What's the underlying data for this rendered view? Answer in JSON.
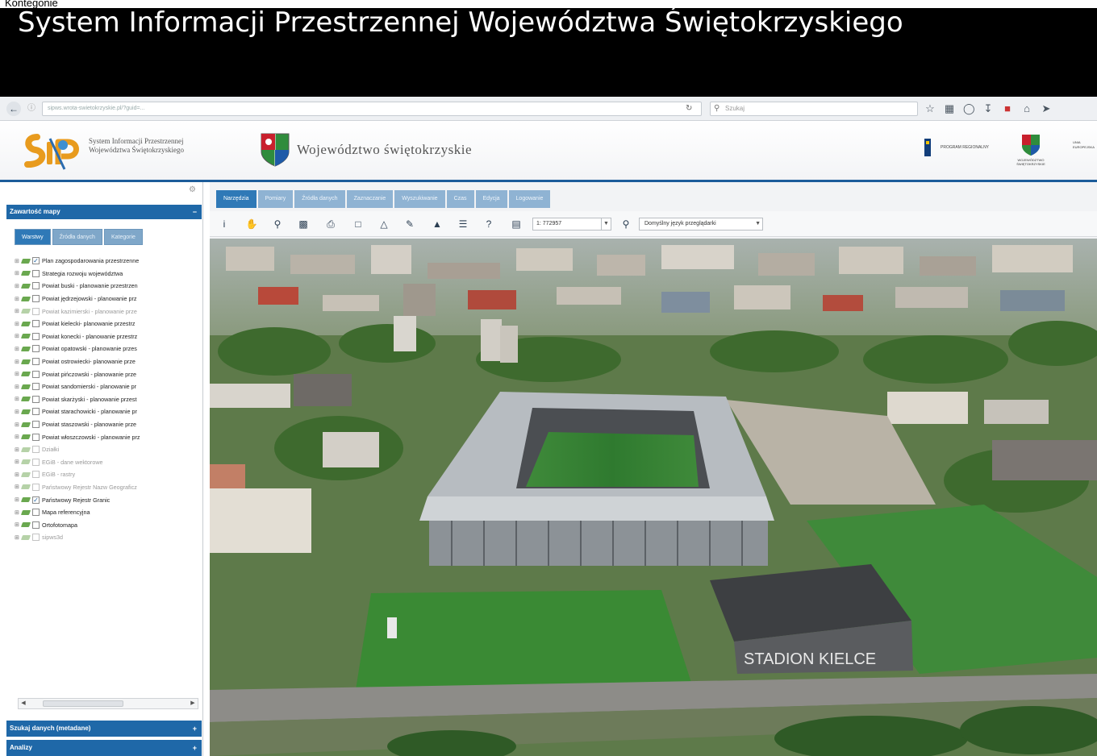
{
  "video": {
    "cut_text": "Kontegonie",
    "title": "System Informacji Przestrzennej Województwa Świętokrzyskiego"
  },
  "browser": {
    "url": "sipws.wrota-swietokrzyskie.pl/?guid=...",
    "search_placeholder": "Szukaj"
  },
  "header": {
    "sip_name_line1": "System Informacji Przestrzennej",
    "sip_name_line2": "Województwa Świętokrzyskiego",
    "region_name": "Województwo świętokrzyskie",
    "partner_name": "PROGRAM REGIONALNY",
    "crest_caption_line1": "WOJEWÓDZTWO",
    "crest_caption_line2": "ŚWIĘTOKRZYSKIE",
    "edge_line1": "UNIA",
    "edge_line2": "EUROPEJSKA"
  },
  "panel": {
    "title": "Zawartość mapy",
    "tabs": [
      "Warstwy",
      "Źródła danych",
      "Kategorie"
    ],
    "layers": [
      {
        "label": "Plan zagospodarowania przestrzenne",
        "checked": true,
        "dim": false
      },
      {
        "label": "Strategia rozwoju województwa",
        "checked": false,
        "dim": false
      },
      {
        "label": "Powiat buski - planowanie przestrzen",
        "checked": false,
        "dim": false
      },
      {
        "label": "Powiat jędrzejowski - planowanie prz",
        "checked": false,
        "dim": false
      },
      {
        "label": "Powiat kazimierski - planowanie prze",
        "checked": false,
        "dim": true
      },
      {
        "label": "Powiat kielecki- planowanie przestrz",
        "checked": false,
        "dim": false
      },
      {
        "label": "Powiat konecki - planowanie przestrz",
        "checked": false,
        "dim": false
      },
      {
        "label": "Powiat opatowski - planowanie przes",
        "checked": false,
        "dim": false
      },
      {
        "label": "Powiat ostrowiecki- planowanie prze",
        "checked": false,
        "dim": false
      },
      {
        "label": "Powiat pińczowski - planowanie prze",
        "checked": false,
        "dim": false
      },
      {
        "label": "Powiat sandomierski - planowanie pr",
        "checked": false,
        "dim": false
      },
      {
        "label": "Powiat skarżyski - planowanie przest",
        "checked": false,
        "dim": false
      },
      {
        "label": "Powiat starachowicki - planowanie pr",
        "checked": false,
        "dim": false
      },
      {
        "label": "Powiat staszowski - planowanie prze",
        "checked": false,
        "dim": false
      },
      {
        "label": "Powiat włoszczowski - planowanie prz",
        "checked": false,
        "dim": false
      },
      {
        "label": "Działki",
        "checked": false,
        "dim": true
      },
      {
        "label": "EGiB - dane wektorowe",
        "checked": false,
        "dim": true
      },
      {
        "label": "EGiB - rastry",
        "checked": false,
        "dim": true
      },
      {
        "label": "Państwowy Rejestr Nazw Geograficz",
        "checked": false,
        "dim": true
      },
      {
        "label": "Państwowy Rejestr Granic",
        "checked": true,
        "dim": false
      },
      {
        "label": "Mapa referencyjna",
        "checked": false,
        "dim": false
      },
      {
        "label": "Ortofotomapa",
        "checked": false,
        "dim": false
      },
      {
        "label": "sipws3d",
        "checked": false,
        "dim": true
      }
    ],
    "footer_search": "Szukaj danych (metadane)",
    "footer_analysis": "Analizy"
  },
  "map": {
    "menu_tabs": [
      "Narzędzia",
      "Pomiary",
      "Źródła danych",
      "Zaznaczanie",
      "Wyszukiwanie",
      "Czas",
      "Edycja",
      "Logowanie"
    ],
    "scale_value": "1: 772957",
    "language_label": "Domyślny język przeglądarki",
    "stadium_sign": "STADION KIELCE"
  },
  "colors": {
    "accent": "#1f68a8",
    "tab_active": "#2f79b7",
    "tab_inactive": "#8fb3d3",
    "title_bg": "#000000"
  },
  "icons": {
    "toolbar": [
      "info-icon",
      "pan-icon",
      "zoom-icon",
      "save-icon",
      "print-icon",
      "extent-icon",
      "measure-icon",
      "edit-icon",
      "folder-icon",
      "list-icon",
      "help-icon",
      "scale-icon"
    ]
  }
}
